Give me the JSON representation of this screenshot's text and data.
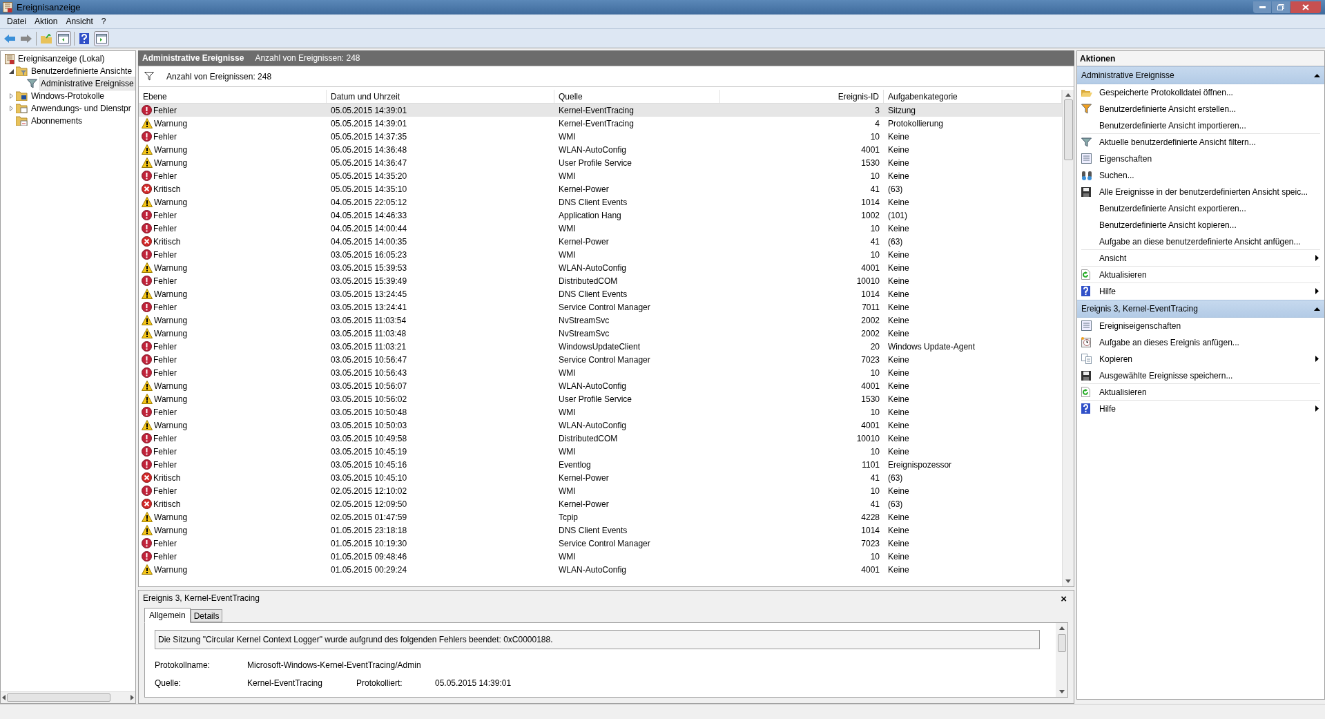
{
  "window": {
    "title": "Ereignisanzeige"
  },
  "menu": [
    {
      "label": "Datei"
    },
    {
      "label": "Aktion"
    },
    {
      "label": "Ansicht"
    },
    {
      "label": "?"
    }
  ],
  "tree": [
    {
      "label": "Ereignisanzeige (Lokal)",
      "selected": false,
      "children": [
        {
          "label": "Benutzerdefinierte Ansichte",
          "expanded": true,
          "selected": false,
          "children": [
            {
              "label": "Administrative Ereignisse",
              "selected": true
            }
          ]
        },
        {
          "label": "Windows-Protokolle",
          "expanded": false,
          "selected": false
        },
        {
          "label": "Anwendungs- und Dienstpr",
          "expanded": false,
          "selected": false
        },
        {
          "label": "Abonnements",
          "selected": false
        }
      ]
    }
  ],
  "center": {
    "title": "Administrative Ereignisse",
    "count": "Anzahl von Ereignissen: 248",
    "filter_count": "Anzahl von Ereignissen: 248"
  },
  "table": {
    "columns": [
      "Ebene",
      "Datum und Uhrzeit",
      "Quelle",
      "Ereignis-ID",
      "Aufgabenkategorie"
    ],
    "rows": [
      {
        "kind": "error",
        "level": "Fehler",
        "date": "05.05.2015 14:39:01",
        "source": "Kernel-EventTracing",
        "id": "3",
        "category": "Sitzung",
        "selected": true
      },
      {
        "kind": "warning",
        "level": "Warnung",
        "date": "05.05.2015 14:39:01",
        "source": "Kernel-EventTracing",
        "id": "4",
        "category": "Protokollierung",
        "selected": false
      },
      {
        "kind": "error",
        "level": "Fehler",
        "date": "05.05.2015 14:37:35",
        "source": "WMI",
        "id": "10",
        "category": "Keine",
        "selected": false
      },
      {
        "kind": "warning",
        "level": "Warnung",
        "date": "05.05.2015 14:36:48",
        "source": "WLAN-AutoConfig",
        "id": "4001",
        "category": "Keine",
        "selected": false
      },
      {
        "kind": "warning",
        "level": "Warnung",
        "date": "05.05.2015 14:36:47",
        "source": "User Profile Service",
        "id": "1530",
        "category": "Keine",
        "selected": false
      },
      {
        "kind": "error",
        "level": "Fehler",
        "date": "05.05.2015 14:35:20",
        "source": "WMI",
        "id": "10",
        "category": "Keine",
        "selected": false
      },
      {
        "kind": "critical",
        "level": "Kritisch",
        "date": "05.05.2015 14:35:10",
        "source": "Kernel-Power",
        "id": "41",
        "category": "(63)",
        "selected": false
      },
      {
        "kind": "warning",
        "level": "Warnung",
        "date": "04.05.2015 22:05:12",
        "source": "DNS Client Events",
        "id": "1014",
        "category": "Keine",
        "selected": false
      },
      {
        "kind": "error",
        "level": "Fehler",
        "date": "04.05.2015 14:46:33",
        "source": "Application Hang",
        "id": "1002",
        "category": "(101)",
        "selected": false
      },
      {
        "kind": "error",
        "level": "Fehler",
        "date": "04.05.2015 14:00:44",
        "source": "WMI",
        "id": "10",
        "category": "Keine",
        "selected": false
      },
      {
        "kind": "critical",
        "level": "Kritisch",
        "date": "04.05.2015 14:00:35",
        "source": "Kernel-Power",
        "id": "41",
        "category": "(63)",
        "selected": false
      },
      {
        "kind": "error",
        "level": "Fehler",
        "date": "03.05.2015 16:05:23",
        "source": "WMI",
        "id": "10",
        "category": "Keine",
        "selected": false
      },
      {
        "kind": "warning",
        "level": "Warnung",
        "date": "03.05.2015 15:39:53",
        "source": "WLAN-AutoConfig",
        "id": "4001",
        "category": "Keine",
        "selected": false
      },
      {
        "kind": "error",
        "level": "Fehler",
        "date": "03.05.2015 15:39:49",
        "source": "DistributedCOM",
        "id": "10010",
        "category": "Keine",
        "selected": false
      },
      {
        "kind": "warning",
        "level": "Warnung",
        "date": "03.05.2015 13:24:45",
        "source": "DNS Client Events",
        "id": "1014",
        "category": "Keine",
        "selected": false
      },
      {
        "kind": "error",
        "level": "Fehler",
        "date": "03.05.2015 13:24:41",
        "source": "Service Control Manager",
        "id": "7011",
        "category": "Keine",
        "selected": false
      },
      {
        "kind": "warning",
        "level": "Warnung",
        "date": "03.05.2015 11:03:54",
        "source": "NvStreamSvc",
        "id": "2002",
        "category": "Keine",
        "selected": false
      },
      {
        "kind": "warning",
        "level": "Warnung",
        "date": "03.05.2015 11:03:48",
        "source": "NvStreamSvc",
        "id": "2002",
        "category": "Keine",
        "selected": false
      },
      {
        "kind": "error",
        "level": "Fehler",
        "date": "03.05.2015 11:03:21",
        "source": "WindowsUpdateClient",
        "id": "20",
        "category": "Windows Update-Agent",
        "selected": false
      },
      {
        "kind": "error",
        "level": "Fehler",
        "date": "03.05.2015 10:56:47",
        "source": "Service Control Manager",
        "id": "7023",
        "category": "Keine",
        "selected": false
      },
      {
        "kind": "error",
        "level": "Fehler",
        "date": "03.05.2015 10:56:43",
        "source": "WMI",
        "id": "10",
        "category": "Keine",
        "selected": false
      },
      {
        "kind": "warning",
        "level": "Warnung",
        "date": "03.05.2015 10:56:07",
        "source": "WLAN-AutoConfig",
        "id": "4001",
        "category": "Keine",
        "selected": false
      },
      {
        "kind": "warning",
        "level": "Warnung",
        "date": "03.05.2015 10:56:02",
        "source": "User Profile Service",
        "id": "1530",
        "category": "Keine",
        "selected": false
      },
      {
        "kind": "error",
        "level": "Fehler",
        "date": "03.05.2015 10:50:48",
        "source": "WMI",
        "id": "10",
        "category": "Keine",
        "selected": false
      },
      {
        "kind": "warning",
        "level": "Warnung",
        "date": "03.05.2015 10:50:03",
        "source": "WLAN-AutoConfig",
        "id": "4001",
        "category": "Keine",
        "selected": false
      },
      {
        "kind": "error",
        "level": "Fehler",
        "date": "03.05.2015 10:49:58",
        "source": "DistributedCOM",
        "id": "10010",
        "category": "Keine",
        "selected": false
      },
      {
        "kind": "error",
        "level": "Fehler",
        "date": "03.05.2015 10:45:19",
        "source": "WMI",
        "id": "10",
        "category": "Keine",
        "selected": false
      },
      {
        "kind": "error",
        "level": "Fehler",
        "date": "03.05.2015 10:45:16",
        "source": "Eventlog",
        "id": "1101",
        "category": "Ereignispozessor",
        "selected": false
      },
      {
        "kind": "critical",
        "level": "Kritisch",
        "date": "03.05.2015 10:45:10",
        "source": "Kernel-Power",
        "id": "41",
        "category": "(63)",
        "selected": false
      },
      {
        "kind": "error",
        "level": "Fehler",
        "date": "02.05.2015 12:10:02",
        "source": "WMI",
        "id": "10",
        "category": "Keine",
        "selected": false
      },
      {
        "kind": "critical",
        "level": "Kritisch",
        "date": "02.05.2015 12:09:50",
        "source": "Kernel-Power",
        "id": "41",
        "category": "(63)",
        "selected": false
      },
      {
        "kind": "warning",
        "level": "Warnung",
        "date": "02.05.2015 01:47:59",
        "source": "Tcpip",
        "id": "4228",
        "category": "Keine",
        "selected": false
      },
      {
        "kind": "warning",
        "level": "Warnung",
        "date": "01.05.2015 23:18:18",
        "source": "DNS Client Events",
        "id": "1014",
        "category": "Keine",
        "selected": false
      },
      {
        "kind": "error",
        "level": "Fehler",
        "date": "01.05.2015 10:19:30",
        "source": "Service Control Manager",
        "id": "7023",
        "category": "Keine",
        "selected": false
      },
      {
        "kind": "error",
        "level": "Fehler",
        "date": "01.05.2015 09:48:46",
        "source": "WMI",
        "id": "10",
        "category": "Keine",
        "selected": false
      },
      {
        "kind": "warning",
        "level": "Warnung",
        "date": "01.05.2015 00:29:24",
        "source": "WLAN-AutoConfig",
        "id": "4001",
        "category": "Keine",
        "selected": false
      }
    ]
  },
  "detail": {
    "title": "Ereignis 3, Kernel-EventTracing",
    "close": "×",
    "tabs": [
      {
        "label": "Allgemein",
        "selected": true
      },
      {
        "label": "Details",
        "selected": false
      }
    ],
    "message": "Die Sitzung \"Circular Kernel Context Logger\" wurde aufgrund des folgenden Fehlers beendet: 0xC0000188.",
    "log_name_label": "Protokollname:",
    "log_name": "Microsoft-Windows-Kernel-EventTracing/Admin",
    "source_label": "Quelle:",
    "source": "Kernel-EventTracing",
    "logged_label": "Protokolliert:",
    "logged": "05.05.2015 14:39:01"
  },
  "actions": {
    "title": "Aktionen",
    "sections": [
      {
        "title": "Administrative Ereignisse",
        "expanded": true,
        "items": [
          {
            "label": "Gespeicherte Protokolldatei öffnen...",
            "submenu": false,
            "divider": false
          },
          {
            "label": "Benutzerdefinierte Ansicht erstellen...",
            "submenu": false,
            "divider": false
          },
          {
            "label": "Benutzerdefinierte Ansicht importieren...",
            "submenu": false,
            "divider": true
          },
          {
            "label": "Aktuelle benutzerdefinierte Ansicht filtern...",
            "submenu": false,
            "divider": false
          },
          {
            "label": "Eigenschaften",
            "submenu": false,
            "divider": false
          },
          {
            "label": "Suchen...",
            "submenu": false,
            "divider": false
          },
          {
            "label": "Alle Ereignisse in der benutzerdefinierten Ansicht speic...",
            "submenu": false,
            "divider": false
          },
          {
            "label": "Benutzerdefinierte Ansicht exportieren...",
            "submenu": false,
            "divider": false
          },
          {
            "label": "Benutzerdefinierte Ansicht kopieren...",
            "submenu": false,
            "divider": false
          },
          {
            "label": "Aufgabe an diese benutzerdefinierte Ansicht anfügen...",
            "submenu": false,
            "divider": true
          },
          {
            "label": "Ansicht",
            "submenu": true,
            "divider": true
          },
          {
            "label": "Aktualisieren",
            "submenu": false,
            "divider": true
          },
          {
            "label": "Hilfe",
            "submenu": true,
            "divider": false
          }
        ]
      },
      {
        "title": "Ereignis 3, Kernel-EventTracing",
        "expanded": true,
        "items": [
          {
            "label": "Ereigniseigenschaften",
            "submenu": false,
            "divider": false
          },
          {
            "label": "Aufgabe an dieses Ereignis anfügen...",
            "submenu": false,
            "divider": false
          },
          {
            "label": "Kopieren",
            "submenu": true,
            "divider": false
          },
          {
            "label": "Ausgewählte Ereignisse speichern...",
            "submenu": false,
            "divider": true
          },
          {
            "label": "Aktualisieren",
            "submenu": false,
            "divider": true
          },
          {
            "label": "Hilfe",
            "submenu": true,
            "divider": false
          }
        ]
      }
    ]
  }
}
